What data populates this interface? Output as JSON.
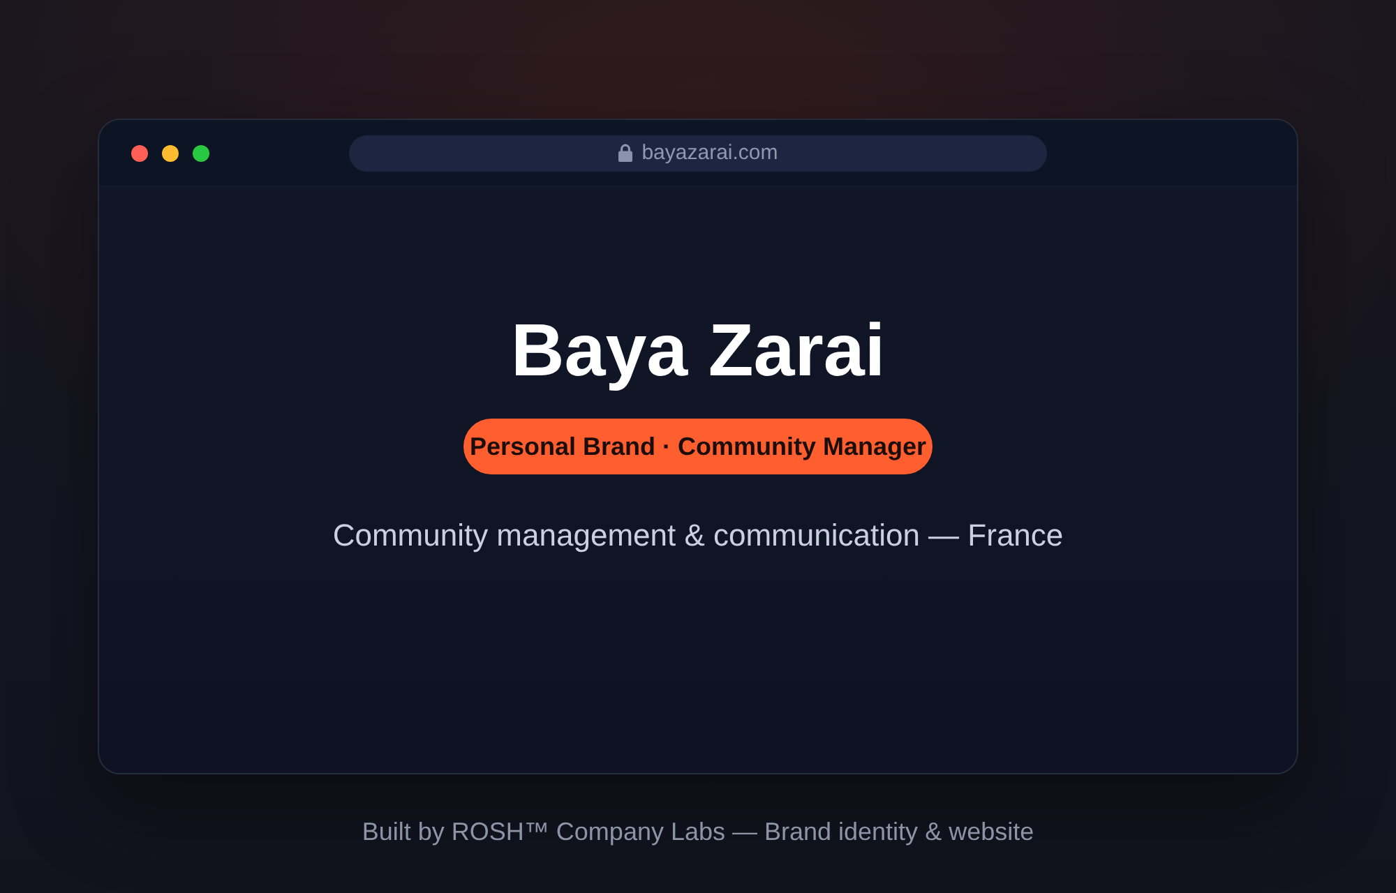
{
  "browser": {
    "traffic_lights": [
      {
        "color": "#ff5f57"
      },
      {
        "color": "#febc2e"
      },
      {
        "color": "#28c840"
      }
    ],
    "url": "bayazarai.com"
  },
  "hero": {
    "title": "Baya Zarai",
    "badge": "Personal Brand · Community Manager",
    "tagline": "Community management & communication — France"
  },
  "footer": "Built by ROSH™ Company Labs — Brand identity & website"
}
